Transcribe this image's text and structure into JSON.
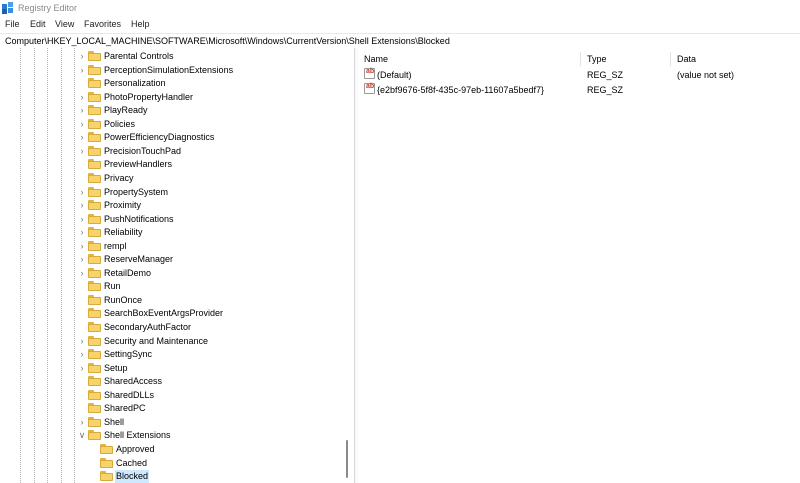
{
  "window": {
    "title": "Registry Editor"
  },
  "menu": [
    "File",
    "Edit",
    "View",
    "Favorites",
    "Help"
  ],
  "address": "Computer\\HKEY_LOCAL_MACHINE\\SOFTWARE\\Microsoft\\Windows\\CurrentVersion\\Shell Extensions\\Blocked",
  "tree": [
    {
      "label": "Parental Controls",
      "expandable": true,
      "level": 0
    },
    {
      "label": "PerceptionSimulationExtensions",
      "expandable": true,
      "level": 0
    },
    {
      "label": "Personalization",
      "expandable": false,
      "level": 0
    },
    {
      "label": "PhotoPropertyHandler",
      "expandable": true,
      "level": 0
    },
    {
      "label": "PlayReady",
      "expandable": true,
      "level": 0
    },
    {
      "label": "Policies",
      "expandable": true,
      "level": 0
    },
    {
      "label": "PowerEfficiencyDiagnostics",
      "expandable": true,
      "level": 0
    },
    {
      "label": "PrecisionTouchPad",
      "expandable": true,
      "level": 0
    },
    {
      "label": "PreviewHandlers",
      "expandable": false,
      "level": 0
    },
    {
      "label": "Privacy",
      "expandable": false,
      "level": 0
    },
    {
      "label": "PropertySystem",
      "expandable": true,
      "level": 0
    },
    {
      "label": "Proximity",
      "expandable": true,
      "level": 0
    },
    {
      "label": "PushNotifications",
      "expandable": true,
      "level": 0
    },
    {
      "label": "Reliability",
      "expandable": true,
      "level": 0
    },
    {
      "label": "rempl",
      "expandable": true,
      "level": 0
    },
    {
      "label": "ReserveManager",
      "expandable": true,
      "level": 0
    },
    {
      "label": "RetailDemo",
      "expandable": true,
      "level": 0
    },
    {
      "label": "Run",
      "expandable": false,
      "level": 0
    },
    {
      "label": "RunOnce",
      "expandable": false,
      "level": 0
    },
    {
      "label": "SearchBoxEventArgsProvider",
      "expandable": false,
      "level": 0
    },
    {
      "label": "SecondaryAuthFactor",
      "expandable": false,
      "level": 0
    },
    {
      "label": "Security and Maintenance",
      "expandable": true,
      "level": 0
    },
    {
      "label": "SettingSync",
      "expandable": true,
      "level": 0
    },
    {
      "label": "Setup",
      "expandable": true,
      "level": 0
    },
    {
      "label": "SharedAccess",
      "expandable": false,
      "level": 0
    },
    {
      "label": "SharedDLLs",
      "expandable": false,
      "level": 0
    },
    {
      "label": "SharedPC",
      "expandable": false,
      "level": 0
    },
    {
      "label": "Shell",
      "expandable": true,
      "level": 0
    },
    {
      "label": "Shell Extensions",
      "expandable": true,
      "expanded": true,
      "level": 0
    },
    {
      "label": "Approved",
      "expandable": false,
      "level": 1
    },
    {
      "label": "Cached",
      "expandable": false,
      "level": 1
    },
    {
      "label": "Blocked",
      "expandable": false,
      "level": 1,
      "selected": true
    }
  ],
  "columns": {
    "name": "Name",
    "type": "Type",
    "data": "Data"
  },
  "values": [
    {
      "icon": "ab",
      "name": "(Default)",
      "type": "REG_SZ",
      "data": "(value not set)"
    },
    {
      "icon": "ab",
      "name": "{e2bf9676-5f8f-435c-97eb-11607a5bedf7}",
      "type": "REG_SZ",
      "data": ""
    }
  ],
  "colors": {
    "selection": "#cde8ff",
    "folder": "#f7d36b"
  }
}
